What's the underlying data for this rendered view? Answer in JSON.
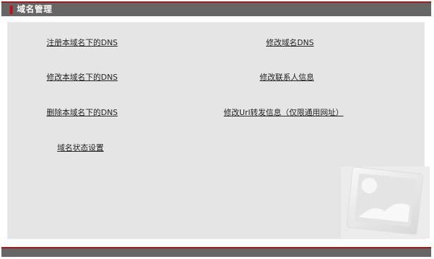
{
  "header": {
    "title": "域名管理"
  },
  "links": {
    "register_dns": "注册本域名下的DNS",
    "modify_domain_dns": "修改域名DNS",
    "modify_dns": "修改本域名下的DNS",
    "modify_contact": "修改联系人信息",
    "delete_dns": "删除本域名下的DNS",
    "modify_url_forward": "修改Url转发信息（仅限通用网址）",
    "domain_status": "域名状态设置"
  },
  "colors": {
    "accent_red": "#a31616",
    "header_gray": "#666666",
    "content_bg": "#e5e5e5"
  },
  "icons": {
    "photo": "image-placeholder-icon"
  }
}
